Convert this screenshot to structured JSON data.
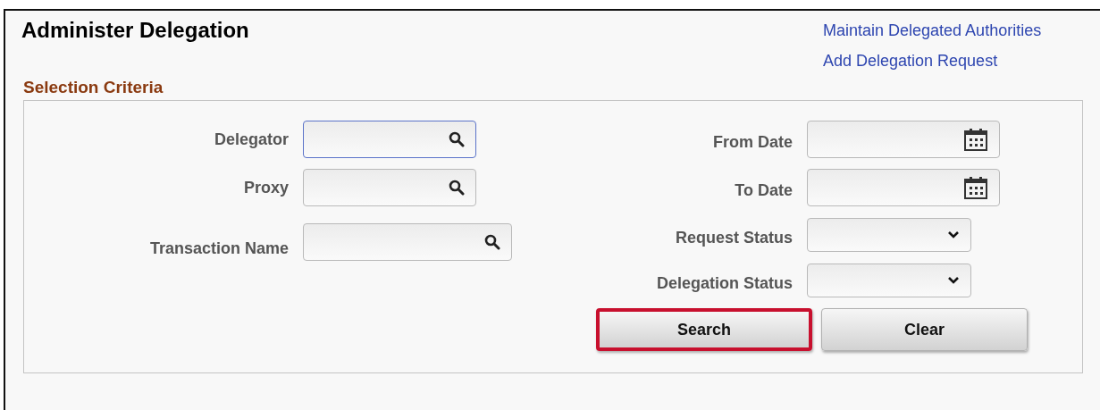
{
  "page": {
    "title": "Administer Delegation"
  },
  "links": [
    {
      "label": "Maintain Delegated Authorities"
    },
    {
      "label": "Add Delegation Request"
    }
  ],
  "section": {
    "title": "Selection Criteria"
  },
  "left_fields": [
    {
      "label": "Delegator",
      "kind": "lookup",
      "focused": true,
      "wide": false
    },
    {
      "label": "Proxy",
      "kind": "lookup",
      "focused": false,
      "wide": false
    },
    {
      "label": "Transaction Name",
      "kind": "lookup",
      "focused": false,
      "wide": true
    }
  ],
  "right_fields": [
    {
      "label": "From Date",
      "kind": "date",
      "focused": false
    },
    {
      "label": "To Date",
      "kind": "date",
      "focused": false
    },
    {
      "label": "Request Status",
      "kind": "select",
      "focused": false
    },
    {
      "label": "Delegation Status",
      "kind": "select",
      "focused": false
    }
  ],
  "buttons": [
    {
      "label": "Search",
      "highlighted": true
    },
    {
      "label": "Clear",
      "highlighted": false
    }
  ]
}
